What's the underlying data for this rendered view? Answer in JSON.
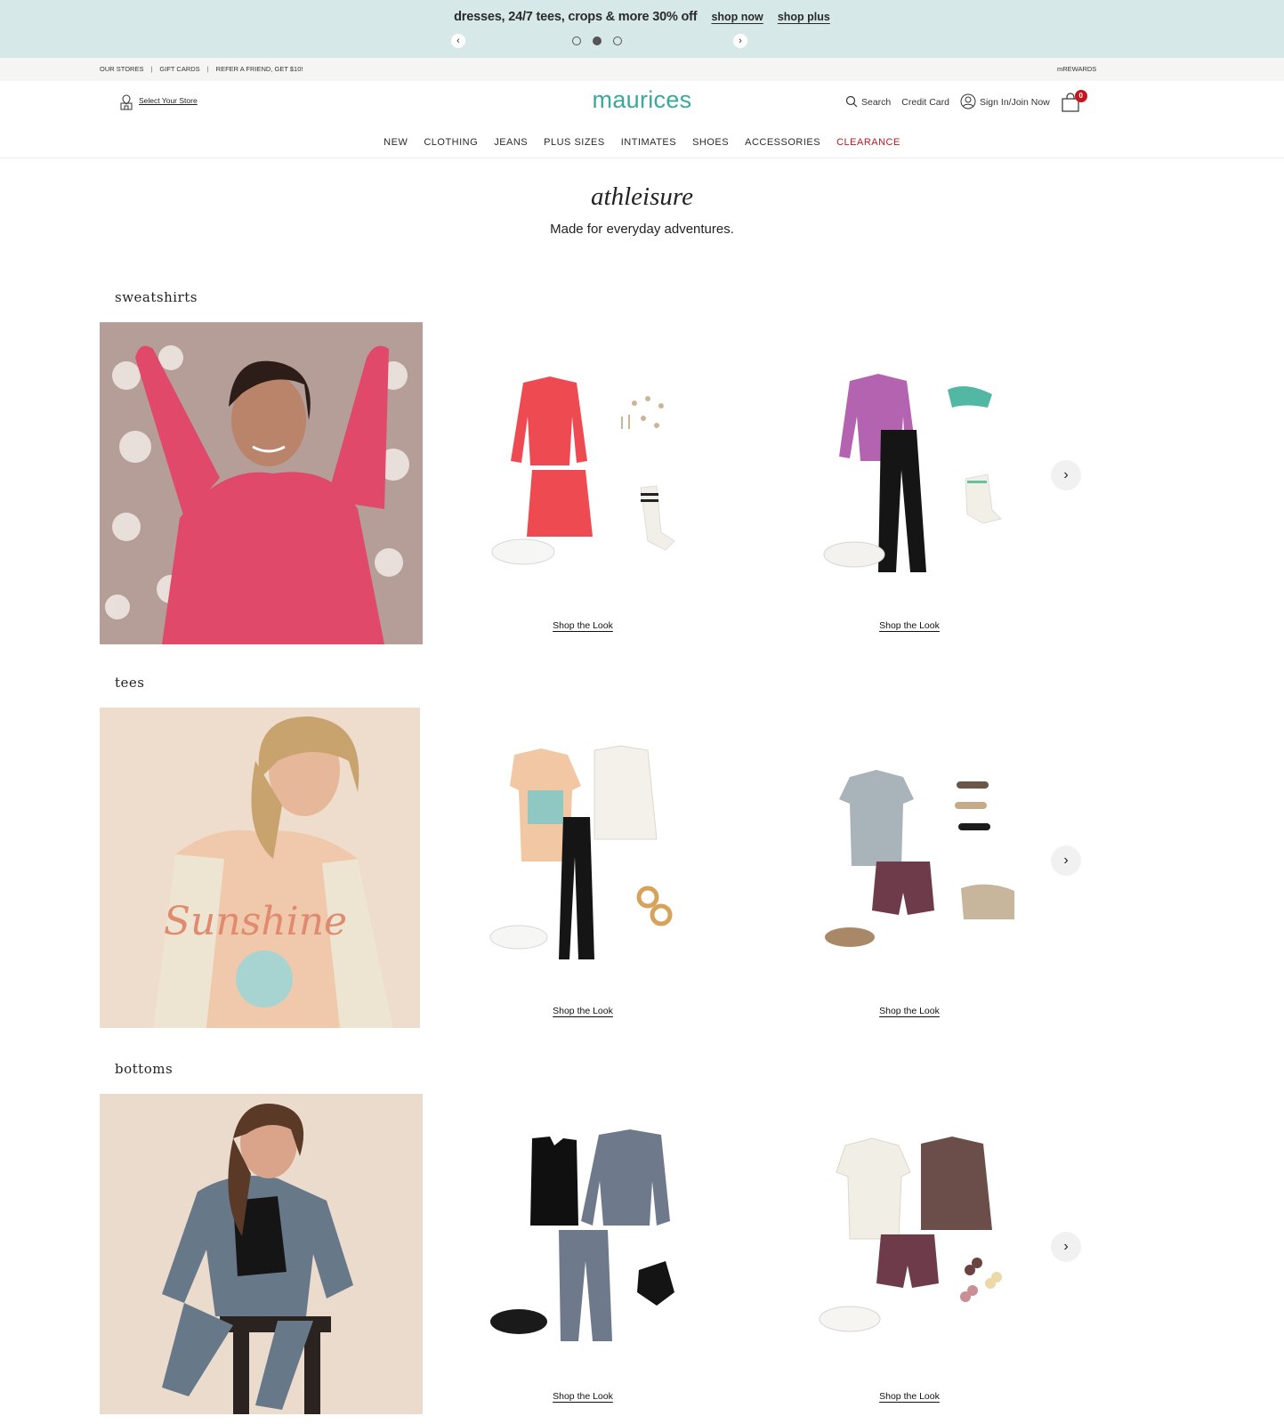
{
  "promo": {
    "text": "dresses, 24/7 tees, crops & more 30% off",
    "shop_now": "shop now",
    "shop_plus": "shop plus",
    "prev_icon": "chevron-left-icon",
    "next_icon": "chevron-right-icon",
    "slides": 3,
    "active_slide": 2
  },
  "util": {
    "our_stores": "OUR STORES",
    "gift_cards": "GIFT CARDS",
    "refer": "REFER A FRIEND, GET $10!",
    "rewards": "mREWARDS"
  },
  "header": {
    "store_label": "Select Your Store",
    "logo": "maurices",
    "search": "Search",
    "credit_card": "Credit Card",
    "sign_in": "Sign In/Join Now",
    "bag_count": "0"
  },
  "nav": {
    "items": [
      "NEW",
      "CLOTHING",
      "JEANS",
      "PLUS SIZES",
      "INTIMATES",
      "SHOES",
      "ACCESSORIES",
      "CLEARANCE"
    ]
  },
  "page": {
    "title": "athleisure",
    "subtitle": "Made for everyday adventures."
  },
  "sections": [
    {
      "label": "sweatshirts",
      "look1_cta": "Shop the Look",
      "look2_cta": "Shop the Look"
    },
    {
      "label": "tees",
      "look1_cta": "Shop the Look",
      "look2_cta": "Shop the Look"
    },
    {
      "label": "bottoms",
      "look1_cta": "Shop the Look",
      "look2_cta": "Shop the Look"
    }
  ],
  "colors": {
    "banner_bg": "#d6e8e7",
    "logo": "#3aa89e",
    "clearance": "#c4161c"
  }
}
